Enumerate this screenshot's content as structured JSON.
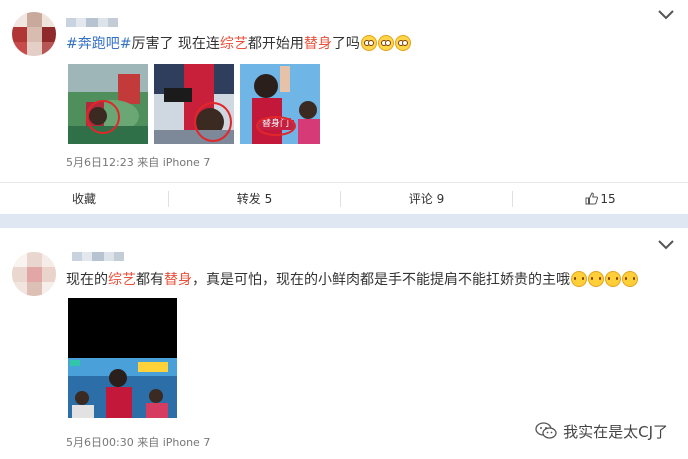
{
  "post1": {
    "text_tag": "#奔跑吧#",
    "text_a": "厉害了 现在连",
    "text_hl1": "综艺",
    "text_b": "都开始用",
    "text_hl2": "替身",
    "text_c": "了吗",
    "meta": "5月6日12:23 来自 iPhone 7",
    "thumb_overlay_text": "替身门",
    "actions": {
      "favorite": "收藏",
      "repost": "转发 5",
      "comment": "评论 9",
      "like_count": "15"
    }
  },
  "post2": {
    "text_a": "现在的",
    "text_hl1": "综艺",
    "text_b": "都有",
    "text_hl2": "替身",
    "text_c": "，真是可怕，现在的小鲜肉都是手不能提肩不能扛娇贵的主哦",
    "meta": "5月6日00:30 来自 iPhone 7"
  },
  "watermark": "我实在是太CJ了",
  "colors": {
    "highlight": "#e8503a",
    "hashtag": "#3572c6",
    "separator": "#dfe7f3"
  },
  "icons": [
    "chevron-down-icon",
    "like-thumb-icon",
    "wechat-icon",
    "flushed-face-emoji",
    "tongue-face-emoji"
  ]
}
